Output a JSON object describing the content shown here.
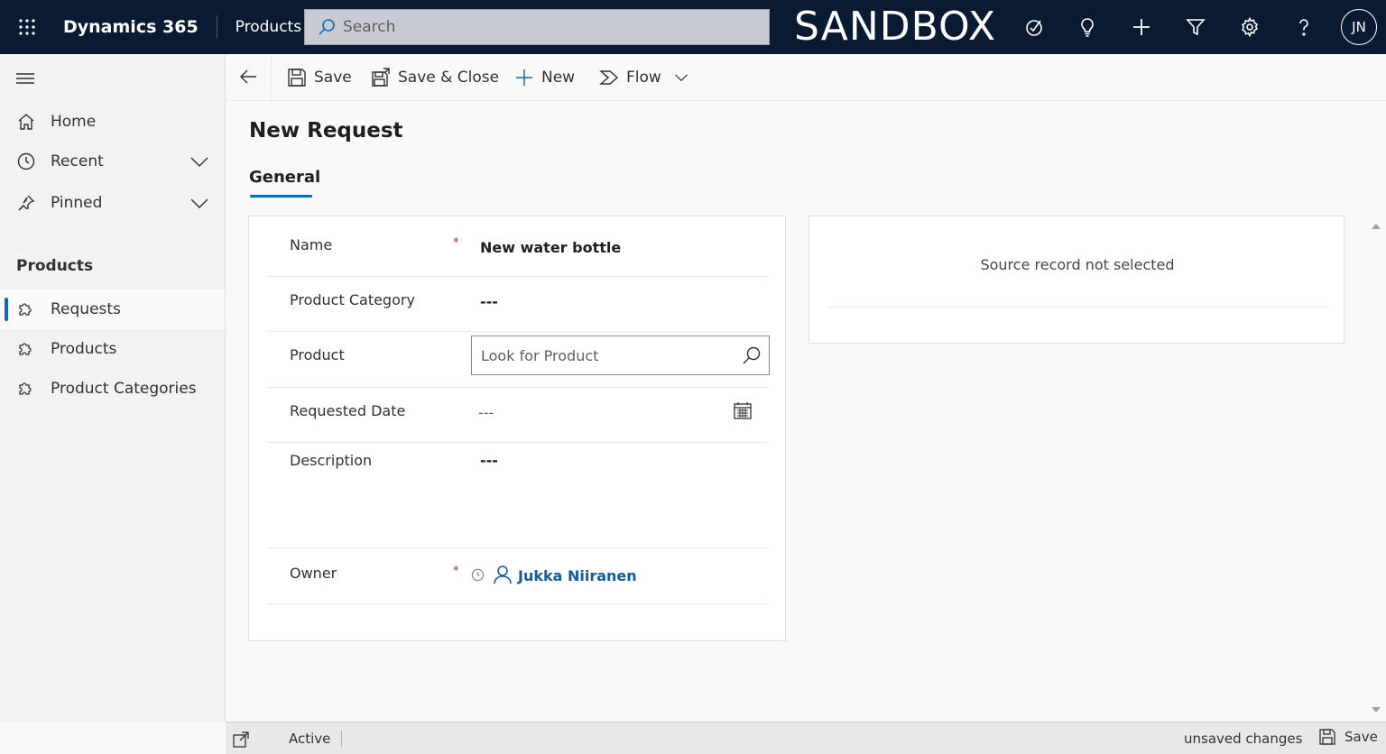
{
  "topbar": {
    "app_title": "Dynamics 365",
    "area": "Products",
    "search_placeholder": "Search",
    "environment_banner": "SANDBOX",
    "icons": [
      "waffle-icon",
      "search-icon",
      "task-icon",
      "lightbulb-icon",
      "plus-icon",
      "filter-icon",
      "settings-icon",
      "help-icon"
    ],
    "user_initials": "JN"
  },
  "sidebar": {
    "items": [
      {
        "label": "Home",
        "icon": "home-icon"
      },
      {
        "label": "Recent",
        "icon": "clock-icon",
        "expandable": true
      },
      {
        "label": "Pinned",
        "icon": "pin-icon",
        "expandable": true
      }
    ],
    "group_title": "Products",
    "group_items": [
      {
        "label": "Requests",
        "icon": "puzzle-icon",
        "active": true
      },
      {
        "label": "Products",
        "icon": "puzzle-icon"
      },
      {
        "label": "Product Categories",
        "icon": "puzzle-icon"
      }
    ]
  },
  "commandbar": {
    "save": "Save",
    "save_close": "Save & Close",
    "new": "New",
    "flow": "Flow"
  },
  "form": {
    "title": "New Request",
    "tab": "General",
    "fields": {
      "name": {
        "label": "Name",
        "required": "*",
        "value": "New water bottle"
      },
      "product_category": {
        "label": "Product Category",
        "value": "---"
      },
      "product": {
        "label": "Product",
        "placeholder": "Look for Product"
      },
      "requested_date": {
        "label": "Requested Date",
        "value": "---"
      },
      "description": {
        "label": "Description",
        "value": "---"
      },
      "owner": {
        "label": "Owner",
        "required": "*",
        "value": "Jukka Niiranen"
      }
    }
  },
  "side_panel": {
    "message": "Source record not selected"
  },
  "footer": {
    "status": "Active",
    "unsaved": "unsaved changes",
    "save": "Save"
  },
  "colors": {
    "topbar_bg": "#0b1a33",
    "accent": "#0f6cbd",
    "required": "#a4262c",
    "link": "#0f5ca8"
  }
}
